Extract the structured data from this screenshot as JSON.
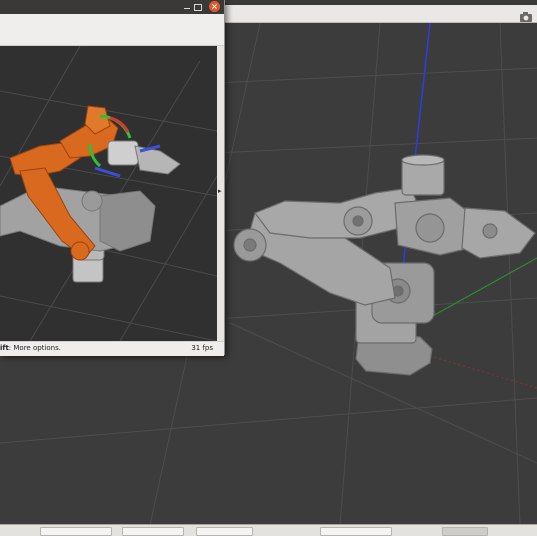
{
  "moveit_window": {
    "close_glyph": "×",
    "status": {
      "key": "ift",
      "text": ": More options.",
      "fps": "31 fps"
    },
    "splitter_glyph": "▸"
  },
  "gazebo_window": {
    "icons": [
      "camera-icon"
    ]
  },
  "colors": {
    "robot_orange": "#d9691e",
    "robot_gray": "#9a9a9a",
    "grid_line": "#555555",
    "axis_blue": "#2a3cf0",
    "axis_green": "#2e8b2e",
    "axis_red": "#b33a3a"
  }
}
